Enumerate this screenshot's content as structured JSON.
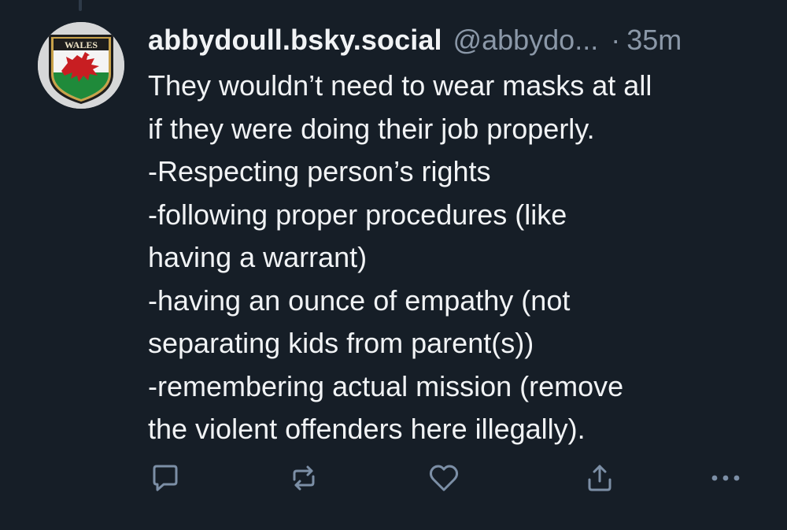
{
  "post": {
    "display_name": "abbydoull.bsky.social",
    "handle": "@abbydo...",
    "separator": "·",
    "timestamp": "35m",
    "avatar": {
      "badge_text": "WALES",
      "icon": "wales-dragon-badge"
    },
    "text_lines": [
      "They wouldn’t need to wear masks at all",
      "if they were doing their job properly.",
      "-Respecting person’s rights",
      "-following proper procedures (like",
      "having a warrant)",
      "-having an ounce of empathy (not",
      "separating kids from parent(s))",
      "-remembering actual mission (remove",
      "the violent offenders here illegally)."
    ]
  },
  "actions": [
    {
      "name": "reply",
      "icon": "reply-icon"
    },
    {
      "name": "repost",
      "icon": "repost-icon"
    },
    {
      "name": "like",
      "icon": "heart-icon"
    },
    {
      "name": "share",
      "icon": "share-icon"
    },
    {
      "name": "more",
      "icon": "more-icon"
    }
  ],
  "colors": {
    "background": "#161e27",
    "text": "#f1f3f5",
    "muted": "#8b98a8",
    "icon": "#7c8fa6"
  }
}
